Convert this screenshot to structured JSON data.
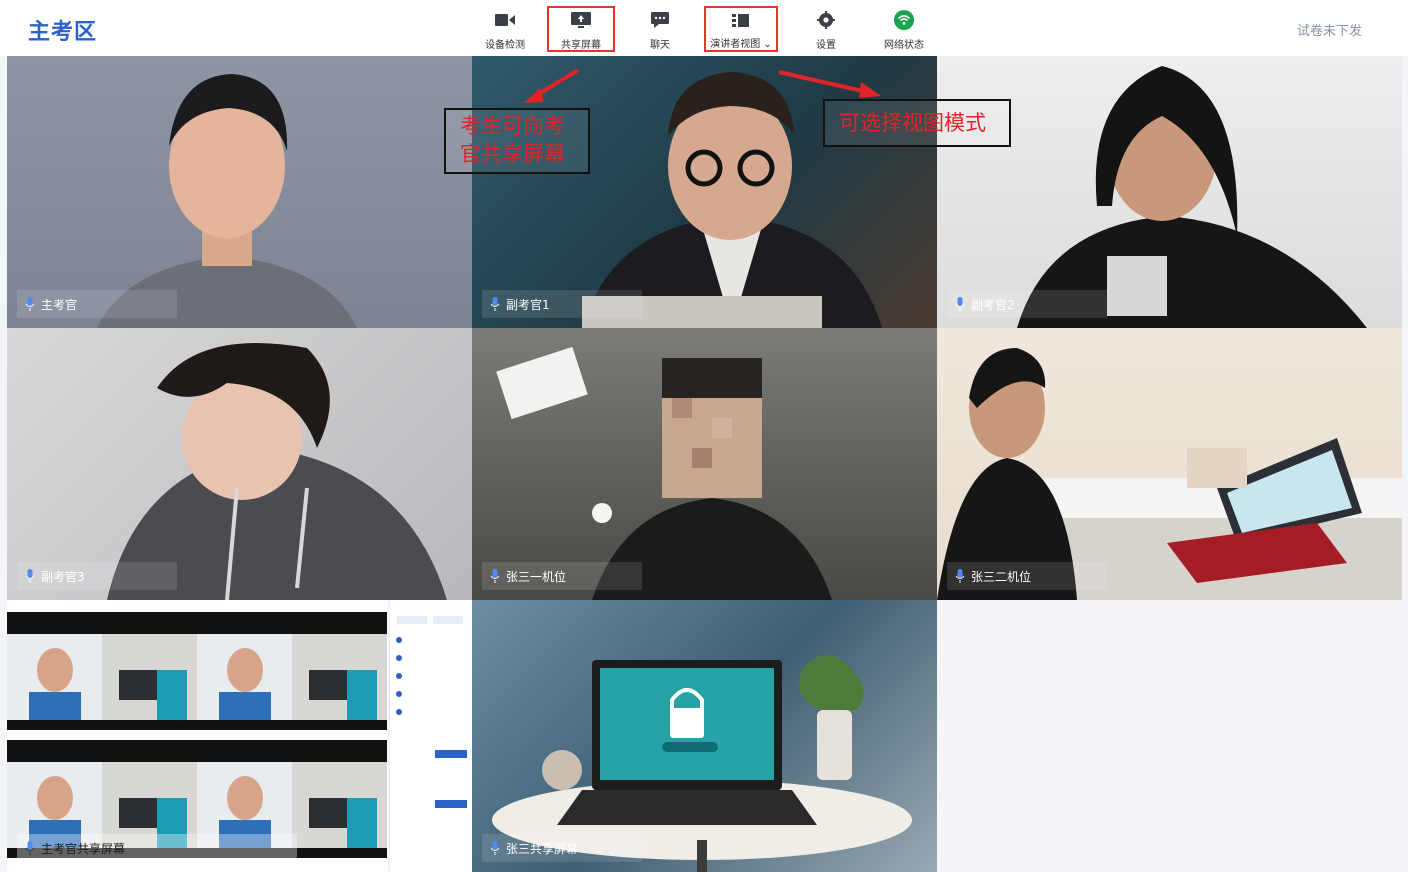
{
  "app": {
    "title": "主考区",
    "status": "试卷未下发"
  },
  "toolbar": {
    "items": [
      {
        "label": "设备检测",
        "icon": "camera-icon"
      },
      {
        "label": "共享屏幕",
        "icon": "screen-share-icon"
      },
      {
        "label": "聊天",
        "icon": "chat-icon"
      },
      {
        "label": "演讲者视图",
        "icon": "speaker-view-icon"
      },
      {
        "label": "设置",
        "icon": "gear-icon"
      },
      {
        "label": "网络状态",
        "icon": "wifi-icon"
      }
    ]
  },
  "annotations": {
    "share": "考生可向考官共享屏幕",
    "view": "可选择视图模式"
  },
  "tiles": [
    {
      "name": "主考官"
    },
    {
      "name": "副考官1"
    },
    {
      "name": "副考官2"
    },
    {
      "name": "副考官3"
    },
    {
      "name": "张三一机位"
    },
    {
      "name": "张三二机位"
    },
    {
      "name": "主考官共享屏幕"
    },
    {
      "name": "张三共享屏幕"
    }
  ],
  "colors": {
    "brand": "#2a62c9",
    "annotation": "#e0242a",
    "wifi": "#1aa34a"
  }
}
